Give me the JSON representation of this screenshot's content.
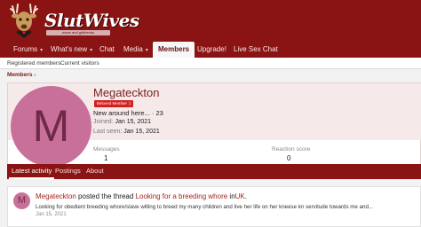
{
  "site": {
    "logo_text": "SlutWives",
    "tagline": "wives and girlfriends"
  },
  "nav": {
    "items": [
      {
        "label": "Forums",
        "caret": "▾"
      },
      {
        "label": "What's new",
        "caret": "▾"
      },
      {
        "label": "Chat",
        "caret": ""
      },
      {
        "label": "Media",
        "caret": "▾"
      },
      {
        "label": "Members",
        "caret": ""
      },
      {
        "label": "Upgrade!",
        "caret": ""
      },
      {
        "label": "Live Sex Chat",
        "caret": ""
      }
    ]
  },
  "subnav": {
    "items": [
      "Registered members",
      "Current visitors"
    ]
  },
  "breadcrumb": {
    "label": "Members",
    "caret": "›"
  },
  "profile": {
    "avatar_letter": "M",
    "username": "Megateckton",
    "badge": "Beloved Member :)",
    "user_title": "New around here...",
    "title_suffix": "· 23",
    "joined_label": "Joined:",
    "joined_value": "Jan 15, 2021",
    "last_seen_label": "Last seen:",
    "last_seen_value": "Jan 15, 2021",
    "stats": [
      {
        "label": "Messages",
        "value": "1"
      },
      {
        "label": "Reaction score",
        "value": "0"
      }
    ]
  },
  "tabs": {
    "items": [
      "Latest activity",
      "Postings",
      "About"
    ]
  },
  "feed": {
    "avatar_letter": "M",
    "user": "Megateckton",
    "action": "posted the thread",
    "thread": "Looking for a breeding whore",
    "prep": "in",
    "forum": "UK",
    "end": ".",
    "snippet": "Looking for obedient breeding whore/slave willing to breed my many children and live her life on her kneese kn servitude towards me and...",
    "date": "Jan 15, 2021"
  },
  "colors": {
    "brand": "#8a1414",
    "accent": "#d41f1f",
    "avatar_bg": "#c9709a",
    "link": "#a3241e"
  }
}
